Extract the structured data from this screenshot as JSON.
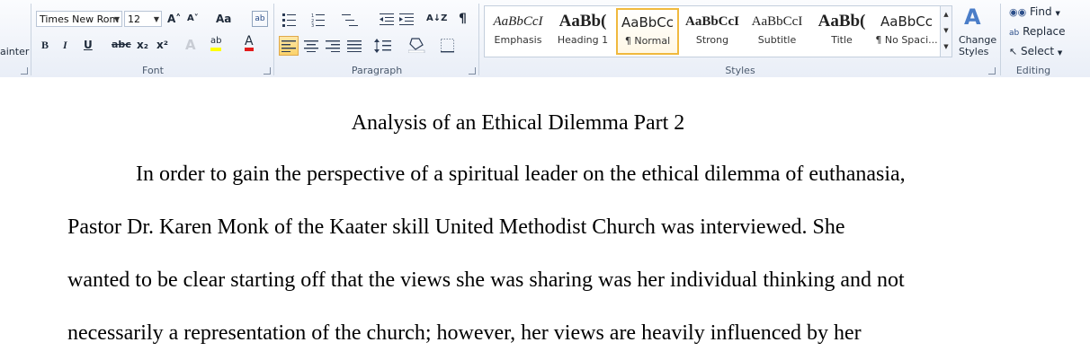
{
  "clipboard": {
    "painter_label": "ainter"
  },
  "font": {
    "group_label": "Font",
    "font_name": "Times New Rom",
    "font_size": "12",
    "grow_label": "A˄",
    "shrink_label": "A˅",
    "case_label": "Aa",
    "bold_label": "B",
    "italic_label": "I",
    "underline_label": "U",
    "strike_label": "abc",
    "subscript_label": "x₂",
    "superscript_label": "x²",
    "effects_label": "A",
    "highlight_label": "ab",
    "font_color_label": "A"
  },
  "paragraph": {
    "group_label": "Paragraph",
    "sort_label": "A↓Z",
    "pilcrow_label": "¶"
  },
  "styles": {
    "group_label": "Styles",
    "items": [
      {
        "preview": "AaBbCcI",
        "name": "Emphasis"
      },
      {
        "preview": "AaBb(",
        "name": "Heading 1"
      },
      {
        "preview": "AaBbCc",
        "name": "¶ Normal"
      },
      {
        "preview": "AaBbCcI",
        "name": "Strong"
      },
      {
        "preview": "AaBbCcI",
        "name": "Subtitle"
      },
      {
        "preview": "AaBb(",
        "name": "Title"
      },
      {
        "preview": "AaBbCc",
        "name": "¶ No Spaci..."
      }
    ],
    "change_styles_line1": "Change",
    "change_styles_line2": "Styles"
  },
  "editing": {
    "group_label": "Editing",
    "find_label": "Find",
    "replace_label": "Replace",
    "select_label": "Select"
  },
  "document": {
    "title": "Analysis of an Ethical Dilemma Part 2",
    "lines": [
      "In order to gain the perspective of a spiritual leader on the ethical dilemma of euthanasia,",
      "Pastor Dr. Karen Monk of the Kaater skill United Methodist Church was interviewed. She",
      "wanted to be clear starting off that the views she was sharing was her individual thinking and not",
      "necessarily a representation of the church; however, her views are heavily influenced by her"
    ]
  },
  "colors": {
    "highlight": "#ffff00",
    "font_color": "#e31b1b",
    "active_style_border": "#f0b93e"
  }
}
